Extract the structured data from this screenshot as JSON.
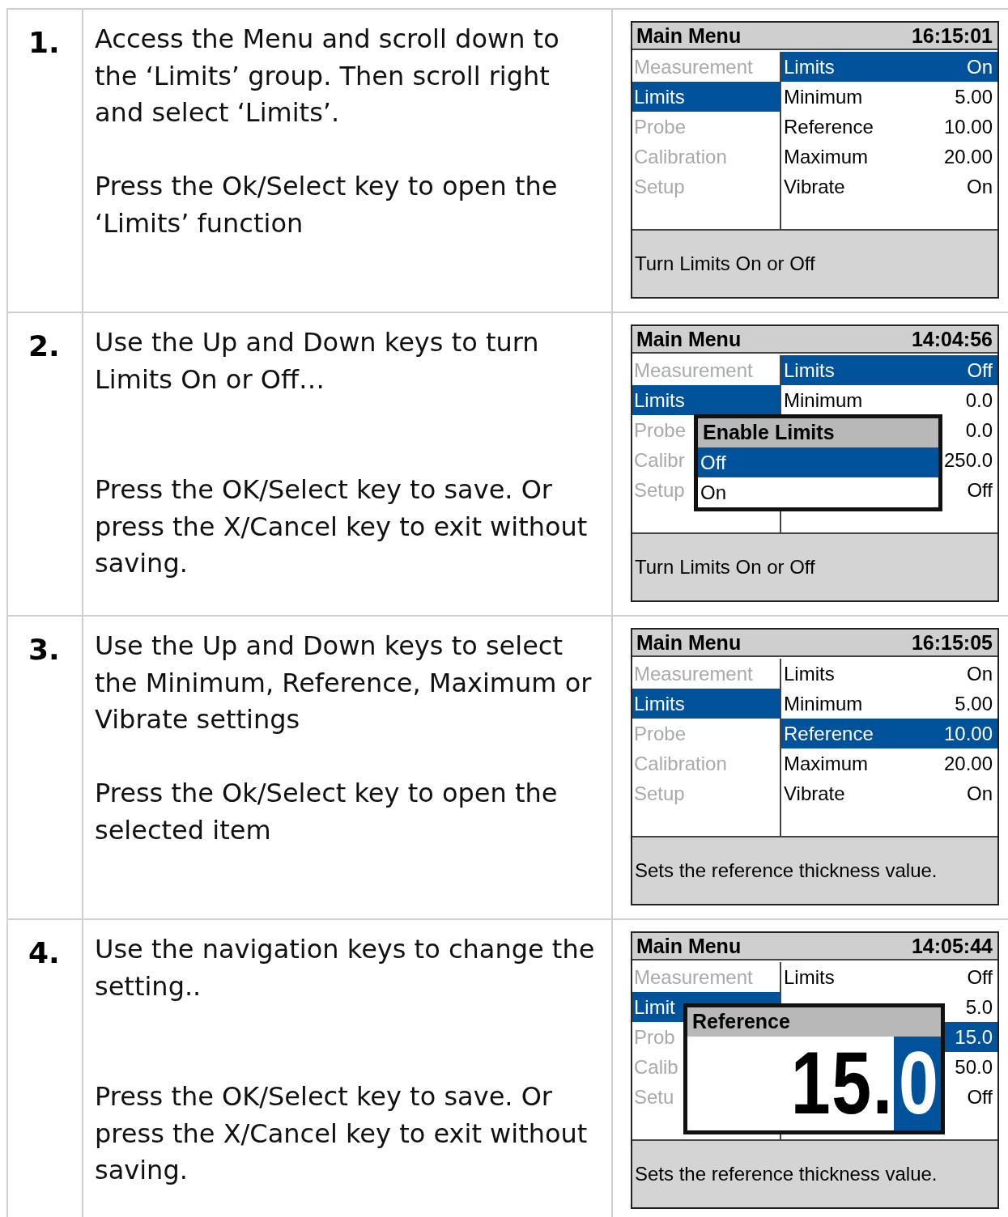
{
  "steps": [
    {
      "number": "1.",
      "paragraphs": [
        "Access the Menu and scroll down to the ‘Limits’ group. Then scroll right and select ‘Limits’.",
        "Press the Ok/Select key to open the ‘Limits’ function"
      ],
      "screen": {
        "title": "Main Menu",
        "time": "16:15:01",
        "menu": [
          {
            "label": "Measurement",
            "selected": false
          },
          {
            "label": "Limits",
            "selected": true
          },
          {
            "label": "Probe",
            "selected": false
          },
          {
            "label": "Calibration",
            "selected": false
          },
          {
            "label": "Setup",
            "selected": false
          }
        ],
        "settings": [
          {
            "label": "Limits",
            "value": "On",
            "selected": true
          },
          {
            "label": "Minimum",
            "value": "5.00",
            "selected": false
          },
          {
            "label": "Reference",
            "value": "10.00",
            "selected": false
          },
          {
            "label": "Maximum",
            "value": "20.00",
            "selected": false
          },
          {
            "label": "Vibrate",
            "value": "On",
            "selected": false
          }
        ],
        "status": "Turn Limits On or Off"
      }
    },
    {
      "number": "2.",
      "paragraphs": [
        "Use the Up and Down keys to turn Limits On or Off…",
        "Press the OK/Select key to save. Or press the X/Cancel key to exit without saving."
      ],
      "screen": {
        "title": "Main Menu",
        "time": "14:04:56",
        "menu": [
          {
            "label": "Measurement",
            "selected": false
          },
          {
            "label": "Limits",
            "selected": true
          },
          {
            "label": "Probe",
            "selected": false
          },
          {
            "label": "Calibr",
            "selected": false
          },
          {
            "label": "Setup",
            "selected": false
          }
        ],
        "settings": [
          {
            "label": "Limits",
            "value": "Off",
            "selected": true
          },
          {
            "label": "Minimum",
            "value": "0.0",
            "selected": false
          },
          {
            "value": "0.0",
            "selected": false
          },
          {
            "value": "250.0",
            "selected": false
          },
          {
            "value": "Off",
            "selected": false
          }
        ],
        "status": "Turn Limits On or Off",
        "popup": {
          "kind": "options",
          "title": "Enable Limits",
          "options": [
            {
              "label": "Off",
              "selected": true
            },
            {
              "label": "On",
              "selected": false
            }
          ]
        }
      }
    },
    {
      "number": "3.",
      "paragraphs": [
        "Use the Up and Down keys to select the Minimum, Reference, Maximum or Vibrate settings",
        "Press the Ok/Select key to open the selected item"
      ],
      "screen": {
        "title": "Main Menu",
        "time": "16:15:05",
        "menu": [
          {
            "label": "Measurement",
            "selected": false
          },
          {
            "label": "Limits",
            "selected": true
          },
          {
            "label": "Probe",
            "selected": false
          },
          {
            "label": "Calibration",
            "selected": false
          },
          {
            "label": "Setup",
            "selected": false
          }
        ],
        "settings": [
          {
            "label": "Limits",
            "value": "On",
            "selected": false
          },
          {
            "label": "Minimum",
            "value": "5.00",
            "selected": false
          },
          {
            "label": "Reference",
            "value": "10.00",
            "selected": true
          },
          {
            "label": "Maximum",
            "value": "20.00",
            "selected": false
          },
          {
            "label": "Vibrate",
            "value": "On",
            "selected": false
          }
        ],
        "status": "Sets the reference thickness value."
      }
    },
    {
      "number": "4.",
      "paragraphs": [
        "Use the navigation keys to change the setting..",
        "Press the OK/Select key to save. Or press the X/Cancel key to exit without saving."
      ],
      "screen": {
        "title": "Main Menu",
        "time": "14:05:44",
        "menu": [
          {
            "label": "Measurement",
            "selected": false
          },
          {
            "label": "Limit",
            "selected": true
          },
          {
            "label": "Prob",
            "selected": false
          },
          {
            "label": "Calib",
            "selected": false
          },
          {
            "label": "Setu",
            "selected": false
          }
        ],
        "settings": [
          {
            "label": "Limits",
            "value": "Off",
            "selected": false
          },
          {
            "value": "5.0",
            "selected": false
          },
          {
            "value": "15.0",
            "selected": true
          },
          {
            "value": "50.0",
            "selected": false
          },
          {
            "value": "Off",
            "selected": false
          }
        ],
        "status": "Sets the reference thickness value.",
        "popup": {
          "kind": "value",
          "title": "Reference",
          "digits": "15.",
          "cursor": "0"
        }
      }
    }
  ]
}
